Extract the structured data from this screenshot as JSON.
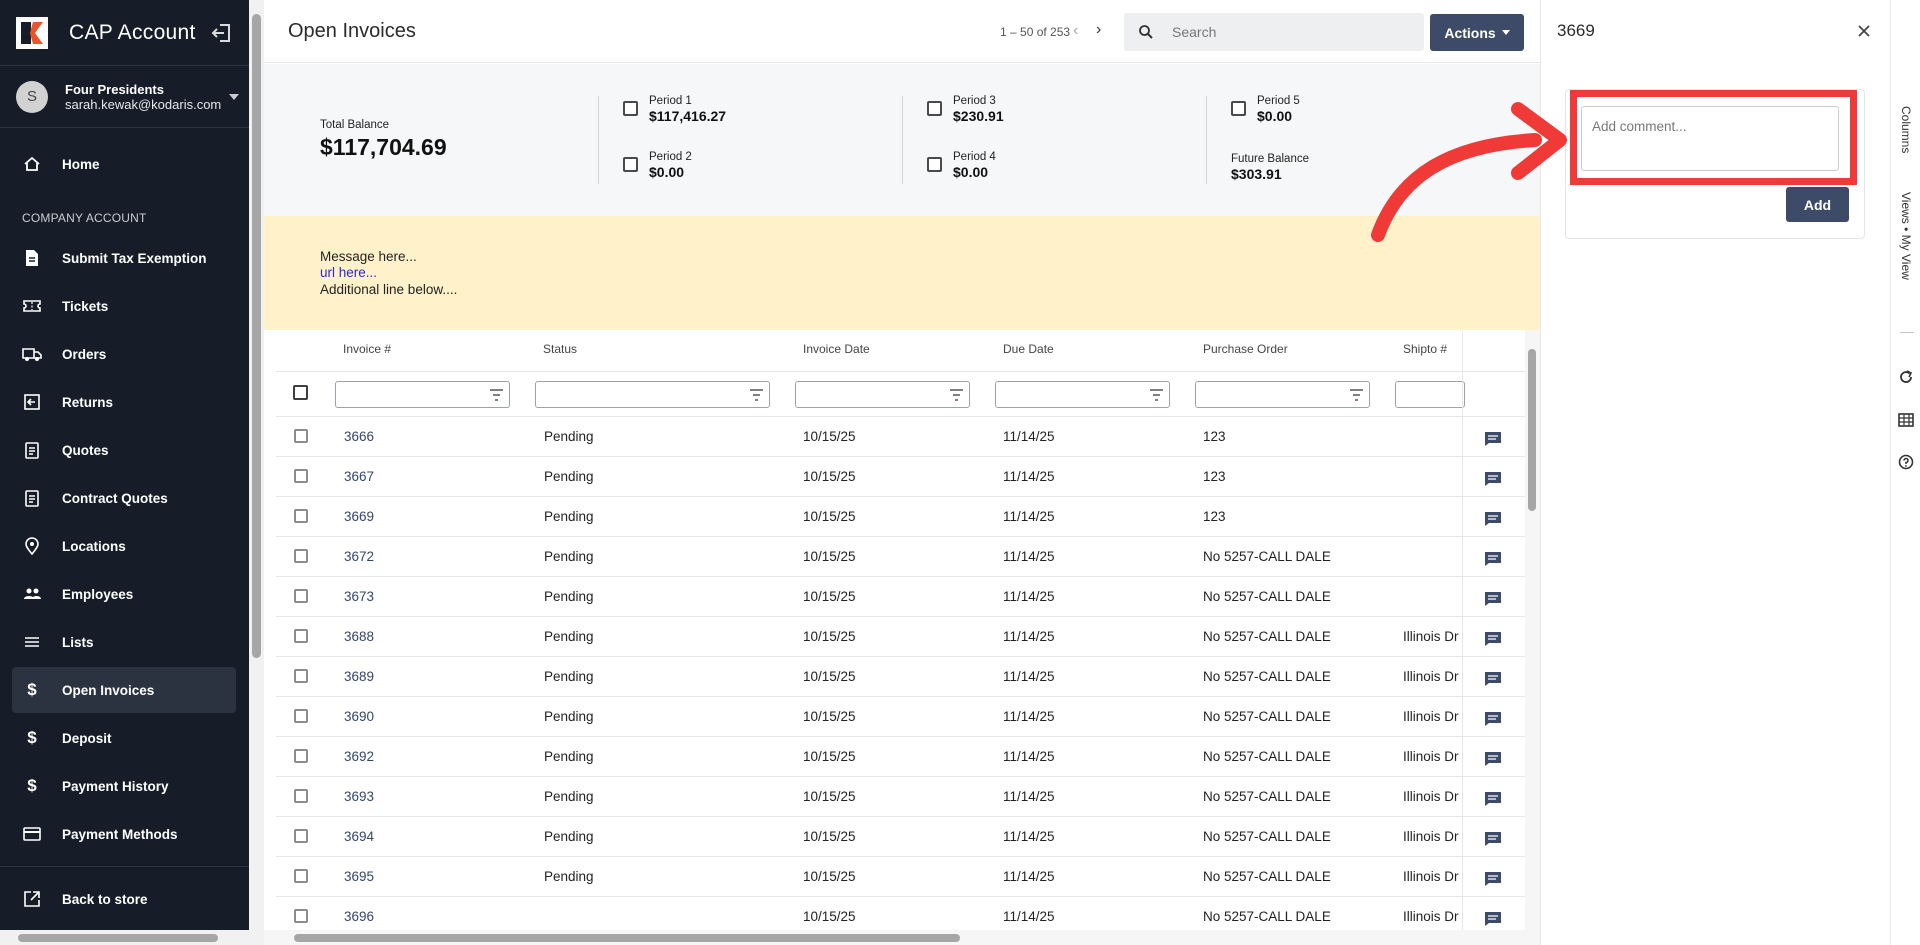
{
  "app": {
    "title": "CAP Account"
  },
  "user": {
    "initial": "S",
    "name": "Four Presidents",
    "email": "sarah.kewak@kodaris.com"
  },
  "sidebar": {
    "home": "Home",
    "section_label": "COMPANY ACCOUNT",
    "items": [
      {
        "label": "Submit Tax Exemption",
        "icon": "document-icon"
      },
      {
        "label": "Tickets",
        "icon": "ticket-icon"
      },
      {
        "label": "Orders",
        "icon": "truck-icon"
      },
      {
        "label": "Returns",
        "icon": "return-icon"
      },
      {
        "label": "Quotes",
        "icon": "clipboard-icon"
      },
      {
        "label": "Contract Quotes",
        "icon": "clipboard-icon"
      },
      {
        "label": "Locations",
        "icon": "location-pin-icon"
      },
      {
        "label": "Employees",
        "icon": "people-icon"
      },
      {
        "label": "Lists",
        "icon": "list-icon"
      },
      {
        "label": "Open Invoices",
        "icon": "dollar-icon"
      },
      {
        "label": "Deposit",
        "icon": "dollar-icon"
      },
      {
        "label": "Payment History",
        "icon": "dollar-icon"
      },
      {
        "label": "Payment Methods",
        "icon": "credit-card-icon"
      }
    ],
    "back_to_store": "Back to store"
  },
  "header": {
    "title": "Open Invoices",
    "pagination": "1 – 50 of 253",
    "search_placeholder": "Search",
    "actions_label": "Actions"
  },
  "balances": {
    "total_label": "Total Balance",
    "total_value": "$117,704.69",
    "periods": [
      {
        "label": "Period 1",
        "value": "$117,416.27"
      },
      {
        "label": "Period 2",
        "value": "$0.00"
      },
      {
        "label": "Period 3",
        "value": "$230.91"
      },
      {
        "label": "Period 4",
        "value": "$0.00"
      },
      {
        "label": "Period 5",
        "value": "$0.00"
      }
    ],
    "future_label": "Future Balance",
    "future_value": "$303.91"
  },
  "message": {
    "line1": "Message here...",
    "link": "url here...",
    "line2": "Additional line below...."
  },
  "table": {
    "columns": [
      "Invoice #",
      "Status",
      "Invoice Date",
      "Due Date",
      "Purchase Order",
      "Shipto #"
    ],
    "rows": [
      [
        "3666",
        "Pending",
        "10/15/25",
        "11/14/25",
        "123",
        ""
      ],
      [
        "3667",
        "Pending",
        "10/15/25",
        "11/14/25",
        "123",
        ""
      ],
      [
        "3669",
        "Pending",
        "10/15/25",
        "11/14/25",
        "123",
        ""
      ],
      [
        "3672",
        "Pending",
        "10/15/25",
        "11/14/25",
        "No 5257-CALL DALE",
        ""
      ],
      [
        "3673",
        "Pending",
        "10/15/25",
        "11/14/25",
        "No 5257-CALL DALE",
        ""
      ],
      [
        "3688",
        "Pending",
        "10/15/25",
        "11/14/25",
        "No 5257-CALL DALE",
        "Illinois Dr"
      ],
      [
        "3689",
        "Pending",
        "10/15/25",
        "11/14/25",
        "No 5257-CALL DALE",
        "Illinois Dr"
      ],
      [
        "3690",
        "Pending",
        "10/15/25",
        "11/14/25",
        "No 5257-CALL DALE",
        "Illinois Dr"
      ],
      [
        "3692",
        "Pending",
        "10/15/25",
        "11/14/25",
        "No 5257-CALL DALE",
        "Illinois Dr"
      ],
      [
        "3693",
        "Pending",
        "10/15/25",
        "11/14/25",
        "No 5257-CALL DALE",
        "Illinois Dr"
      ],
      [
        "3694",
        "Pending",
        "10/15/25",
        "11/14/25",
        "No 5257-CALL DALE",
        "Illinois Dr"
      ],
      [
        "3695",
        "Pending",
        "10/15/25",
        "11/14/25",
        "No 5257-CALL DALE",
        "Illinois Dr"
      ],
      [
        "3696",
        "",
        "10/15/25",
        "11/14/25",
        "No 5257-CALL DALE",
        "Illinois Dr"
      ]
    ]
  },
  "detail_panel": {
    "title": "3669",
    "comment_placeholder": "Add comment...",
    "add_label": "Add"
  },
  "right_strip": {
    "columns_label": "Columns",
    "views_label": "Views • My View"
  },
  "colors": {
    "sidebar_bg": "#161d28",
    "primary_button": "#3d4b68",
    "banner_bg": "#fff1c9",
    "highlight_red": "#ef3a37"
  }
}
